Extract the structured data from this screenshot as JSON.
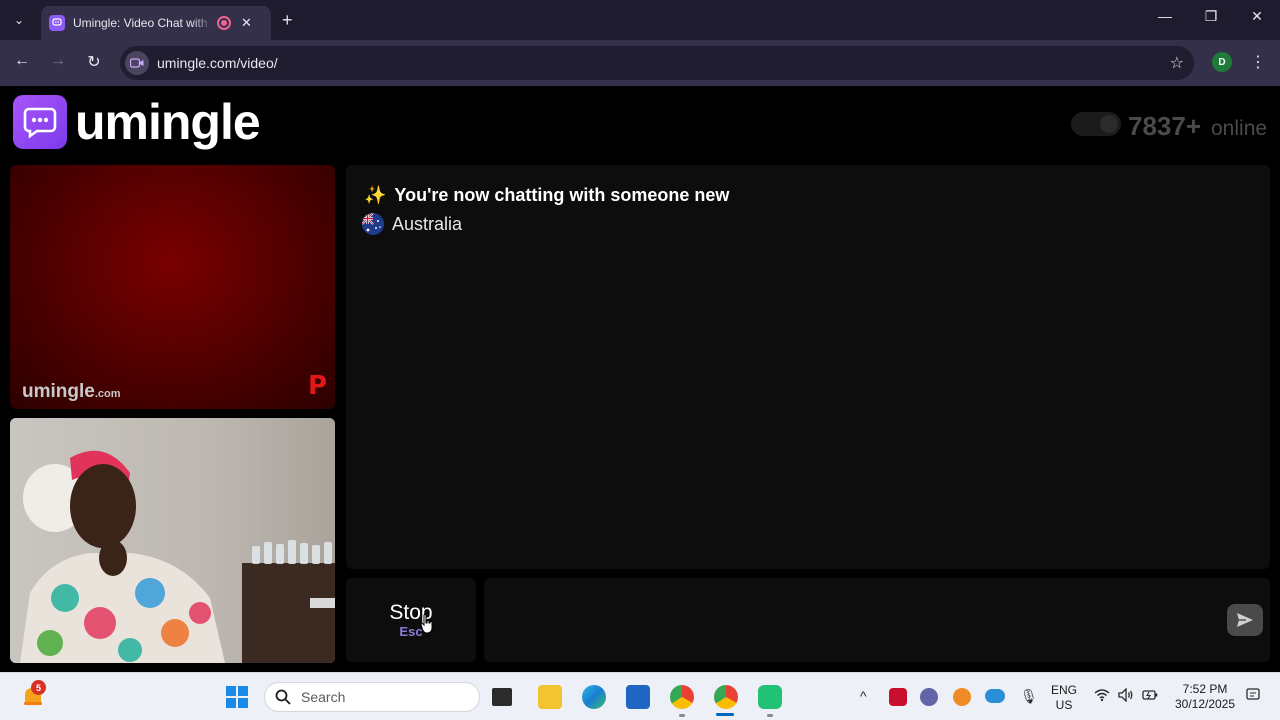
{
  "browser": {
    "tab_title": "Umingle: Video Chat with Strangers",
    "new_tab_symbol": "+",
    "close_tab_symbol": "✕",
    "url": "umingle.com/video/",
    "profile_initial": "D",
    "window_controls": {
      "minimize": "—",
      "restore": "❐",
      "close": "✕"
    },
    "nav": {
      "back": "←",
      "forward": "→",
      "reload": "↻",
      "star": "☆",
      "menu": "⋮",
      "tab_list": "⌄"
    }
  },
  "site": {
    "logo_text": "umingle",
    "online_count": "7837+",
    "online_label": "online"
  },
  "video": {
    "stranger_watermark": "umingle",
    "stranger_watermark_suffix": ".com",
    "stranger_corner_mark": "P"
  },
  "chat": {
    "status_icon": "✨",
    "status_text": "You're now chatting with someone new",
    "country": "Australia",
    "message_value": "",
    "stop_label": "Stop",
    "stop_shortcut": "Esc"
  },
  "taskbar": {
    "notification_count": "5",
    "search_label": "Search",
    "lang_line1": "ENG",
    "lang_line2": "US",
    "time": "7:52 PM",
    "date": "30/12/2025"
  },
  "colors": {
    "brand_purple": "#8b5cf6",
    "stop_hint": "#8b7bd8",
    "browser_frame": "#35304a"
  }
}
